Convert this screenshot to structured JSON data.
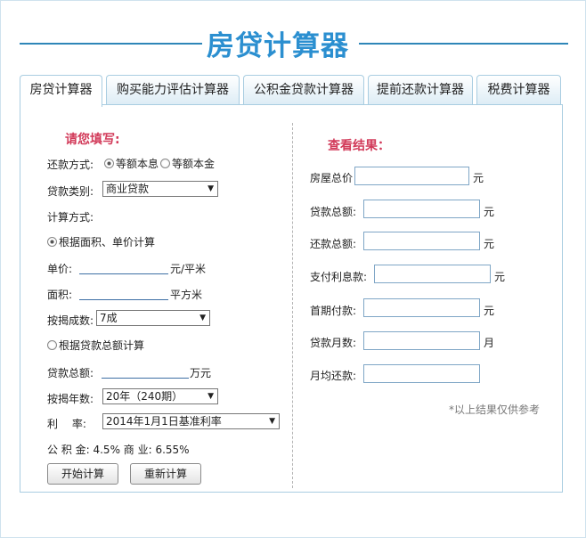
{
  "header": {
    "title": "房贷计算器"
  },
  "tabs": [
    {
      "label": "房贷计算器"
    },
    {
      "label": "购买能力评估计算器"
    },
    {
      "label": "公积金贷款计算器"
    },
    {
      "label": "提前还款计算器"
    },
    {
      "label": "税费计算器"
    }
  ],
  "left": {
    "title": "请您填写:",
    "repay_label": "还款方式:",
    "repay_opt1": "等额本息",
    "repay_opt2": "等额本金",
    "loan_type_label": "贷款类别:",
    "loan_type_value": "商业贷款",
    "calc_method_label": "计算方式:",
    "method1": "根据面积、单价计算",
    "price_label": "单价:",
    "price_value": "",
    "price_unit": "元/平米",
    "area_label": "面积:",
    "area_value": "",
    "area_unit": "平方米",
    "ratio_label": "按揭成数:",
    "ratio_value": "7成",
    "method2": "根据贷款总额计算",
    "total_label": "贷款总额:",
    "total_value": "",
    "total_unit": "万元",
    "years_label": "按揭年数:",
    "years_value": "20年（240期）",
    "rate_label": "利　 率:",
    "rate_value": "2014年1月1日基准利率",
    "rate_info": "公 积 金:  4.5%  商 业:  6.55%",
    "calc_button": "开始计算",
    "reset_button": "重新计算"
  },
  "right": {
    "title": "查看结果：",
    "rows": [
      {
        "label": "房屋总价",
        "unit": "元"
      },
      {
        "label": "贷款总额:",
        "unit": "元"
      },
      {
        "label": "还款总额:",
        "unit": "元"
      },
      {
        "label": "支付利息款:",
        "unit": "元"
      },
      {
        "label": "首期付款:",
        "unit": "元"
      },
      {
        "label": "贷款月数:",
        "unit": "月"
      },
      {
        "label": "月均还款:",
        "unit": ""
      }
    ],
    "note": "*以上结果仅供参考"
  },
  "watermark": {
    "text": ""
  }
}
